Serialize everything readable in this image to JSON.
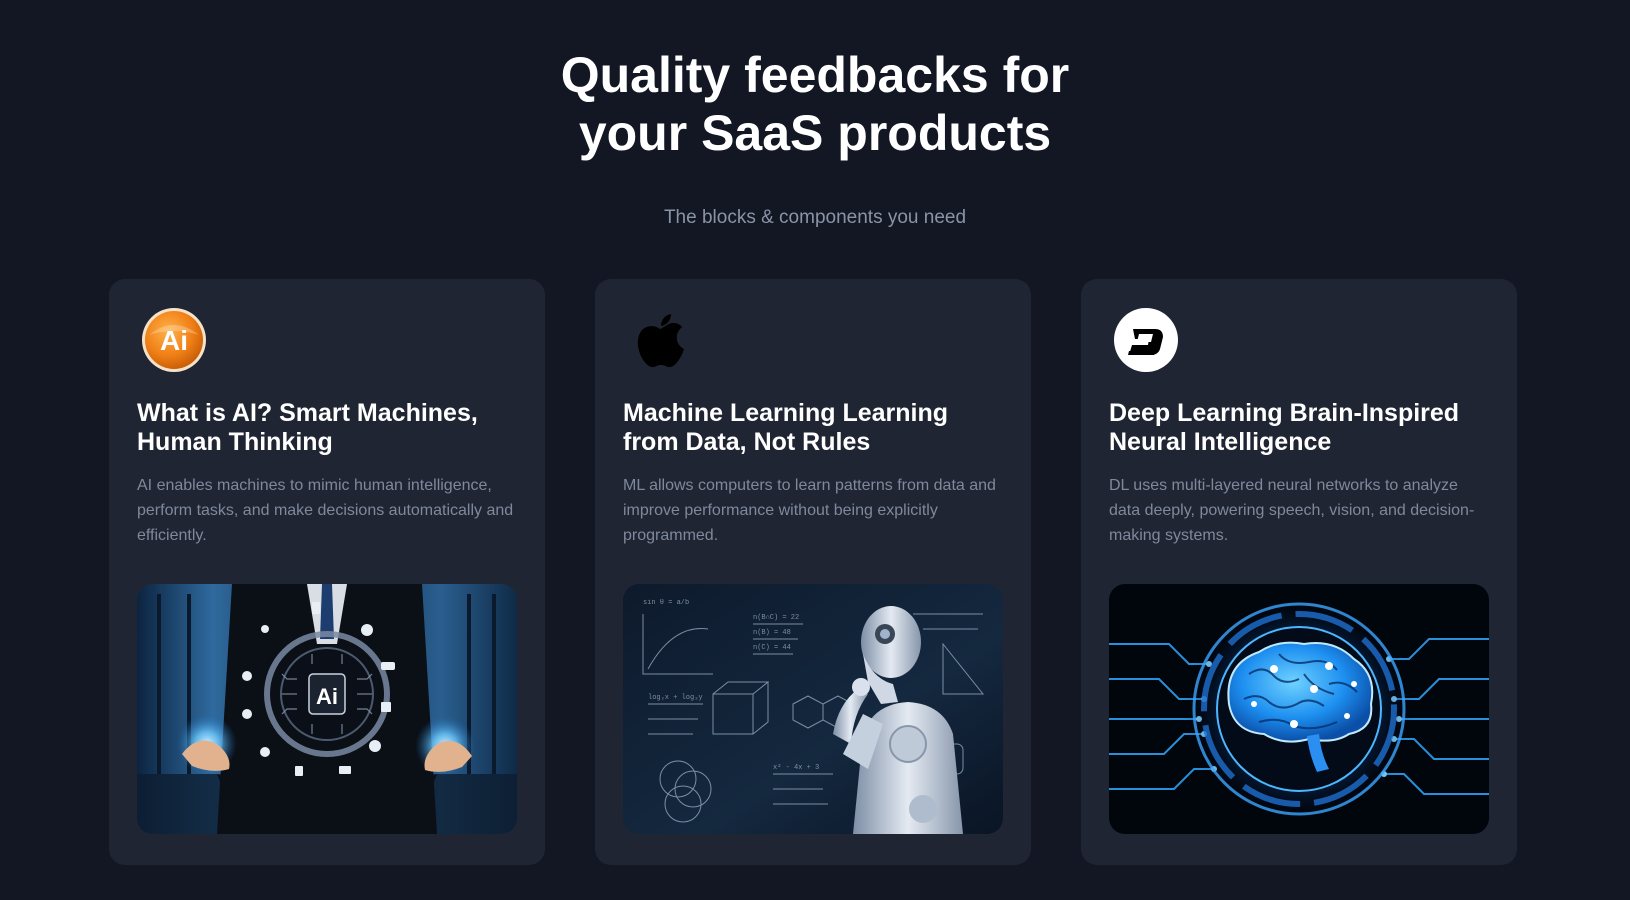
{
  "hero": {
    "title_line1": "Quality feedbacks for",
    "title_line2": "your SaaS products",
    "subtitle": "The blocks & components you need"
  },
  "cards": [
    {
      "icon": "ai-logo-icon",
      "icon_text": "Ai",
      "title_line1": "What is AI? Smart Machines,",
      "title_line2": "Human Thinking",
      "desc_line1": "AI enables machines to mimic human intelligence,",
      "desc_line2": "perform tasks, and make decisions automatically and",
      "desc_line3": "efficiently.",
      "image_label": "Ai"
    },
    {
      "icon": "apple-logo-icon",
      "title_line1": "Machine Learning Learning",
      "title_line2": "from Data, Not Rules",
      "desc_line1": "ML allows computers to learn patterns from data and",
      "desc_line2": "improve performance without being explicitly",
      "desc_line3": "programmed."
    },
    {
      "icon": "dl-logo-icon",
      "title_line1": "Deep Learning Brain-Inspired",
      "title_line2": "Neural Intelligence",
      "desc_line1": "DL uses multi-layered neural networks to analyze",
      "desc_line2": "data deeply, powering speech, vision, and decision-",
      "desc_line3": "making systems."
    }
  ],
  "colors": {
    "background": "#121723",
    "card": "#1f2533",
    "title": "#ffffff",
    "subtitle": "#8a94a6",
    "description": "#7f899b",
    "ai_orange": "#f07f16",
    "neural_blue": "#2ea9ff"
  }
}
